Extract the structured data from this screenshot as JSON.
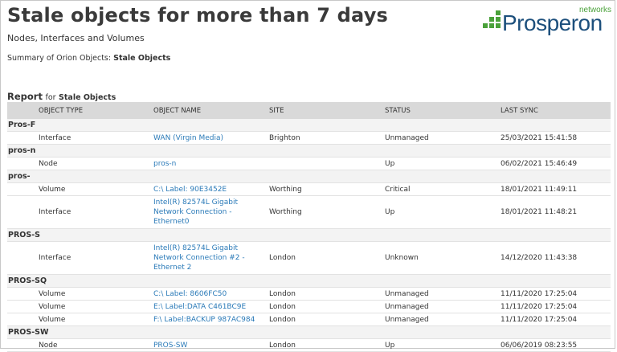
{
  "header": {
    "title": "Stale objects for more than 7 days",
    "subtitle": "Nodes, Interfaces and Volumes",
    "summary_prefix": "Summary of Orion Objects:",
    "summary_value": "Stale Objects"
  },
  "logo": {
    "word": "Prosperon",
    "tagline": "networks",
    "brand_color": "#1c4f7c",
    "accent_color": "#4aa13a"
  },
  "report": {
    "heading": "Report",
    "for_label": "for",
    "object_label": "Stale Objects",
    "columns": [
      "OBJECT TYPE",
      "OBJECT NAME",
      "SITE",
      "STATUS",
      "LAST SYNC"
    ],
    "groups": [
      {
        "name": "Pros-F",
        "rows": [
          {
            "type": "Interface",
            "name": "WAN (Virgin Media)",
            "site": "Brighton",
            "status": "Unmanaged",
            "last_sync": "25/03/2021 15:41:58"
          }
        ]
      },
      {
        "name": "pros-n",
        "rows": [
          {
            "type": "Node",
            "name": "pros-n",
            "site": "",
            "status": "Up",
            "last_sync": "06/02/2021 15:46:49"
          }
        ]
      },
      {
        "name": "pros-",
        "rows": [
          {
            "type": "Volume",
            "name": "C:\\ Label: 90E3452E",
            "site": "Worthing",
            "status": "Critical",
            "last_sync": "18/01/2021 11:49:11"
          },
          {
            "type": "Interface",
            "name": "Intel(R) 82574L Gigabit Network Connection - Ethernet0",
            "site": "Worthing",
            "status": "Up",
            "last_sync": "18/01/2021 11:48:21"
          }
        ]
      },
      {
        "name": "PROS-S",
        "rows": [
          {
            "type": "Interface",
            "name": "Intel(R) 82574L Gigabit Network Connection #2 - Ethernet 2",
            "site": "London",
            "status": "Unknown",
            "last_sync": "14/12/2020 11:43:38"
          }
        ]
      },
      {
        "name": "PROS-SQ",
        "rows": [
          {
            "type": "Volume",
            "name": "C:\\ Label: 8606FC50",
            "site": "London",
            "status": "Unmanaged",
            "last_sync": "11/11/2020 17:25:04"
          },
          {
            "type": "Volume",
            "name": "E:\\ Label:DATA C461BC9E",
            "site": "London",
            "status": "Unmanaged",
            "last_sync": "11/11/2020 17:25:04"
          },
          {
            "type": "Volume",
            "name": "F:\\ Label:BACKUP 987AC984",
            "site": "London",
            "status": "Unmanaged",
            "last_sync": "11/11/2020 17:25:04"
          }
        ]
      },
      {
        "name": "PROS-SW",
        "rows": [
          {
            "type": "Node",
            "name": "PROS-SW",
            "site": "London",
            "status": "Up",
            "last_sync": "06/06/2019 08:23:55"
          }
        ]
      }
    ]
  }
}
